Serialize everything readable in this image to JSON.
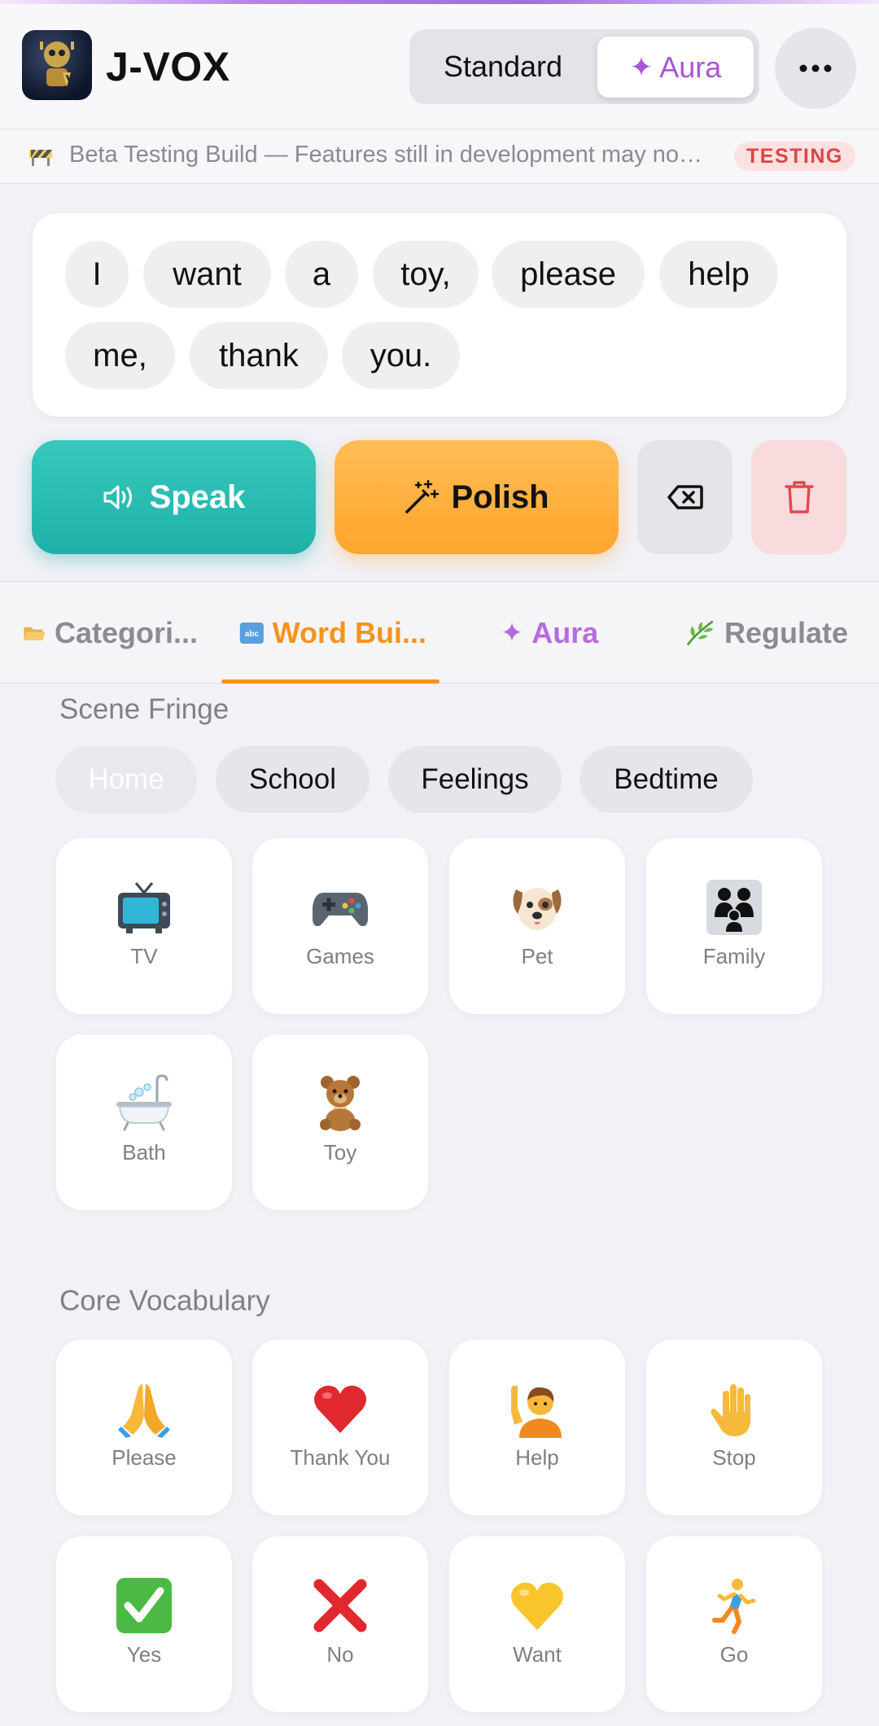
{
  "app": {
    "title": "J-VOX",
    "mode_standard": "Standard",
    "mode_aura": "Aura",
    "more_label": "•••"
  },
  "banner": {
    "text": "Beta Testing Build — Features still in development may not work as expected",
    "badge": "TESTING"
  },
  "sentence": {
    "words": [
      "I",
      "want",
      "a",
      "toy,",
      "please",
      "help",
      "me,",
      "thank",
      "you."
    ]
  },
  "actions": {
    "speak": "Speak",
    "polish": "Polish"
  },
  "tabs": [
    {
      "label": "Categori...",
      "icon": "folder-icon",
      "active": false
    },
    {
      "label": "Word Bui...",
      "icon": "abc-icon",
      "active": true
    },
    {
      "label": "Aura",
      "icon": "sparkle-icon",
      "active": false
    },
    {
      "label": "Regulate",
      "icon": "leaf-icon",
      "active": false
    }
  ],
  "scene_fringe": {
    "title": "Scene Fringe",
    "scenes": [
      "Home",
      "School",
      "Feelings",
      "Bedtime"
    ],
    "selected": "Home",
    "tiles": [
      {
        "label": "TV",
        "icon": "tv-icon"
      },
      {
        "label": "Games",
        "icon": "game-controller-icon"
      },
      {
        "label": "Pet",
        "icon": "dog-icon"
      },
      {
        "label": "Family",
        "icon": "family-icon"
      },
      {
        "label": "Bath",
        "icon": "bathtub-icon"
      },
      {
        "label": "Toy",
        "icon": "teddy-bear-icon"
      }
    ]
  },
  "core_vocabulary": {
    "title": "Core Vocabulary",
    "tiles": [
      {
        "label": "Please",
        "icon": "folded-hands-icon"
      },
      {
        "label": "Thank You",
        "icon": "red-heart-icon"
      },
      {
        "label": "Help",
        "icon": "raised-hand-person-icon"
      },
      {
        "label": "Stop",
        "icon": "raised-hand-icon"
      },
      {
        "label": "Yes",
        "icon": "check-mark-icon"
      },
      {
        "label": "No",
        "icon": "cross-mark-icon"
      },
      {
        "label": "Want",
        "icon": "yellow-heart-icon"
      },
      {
        "label": "Go",
        "icon": "running-person-icon"
      }
    ]
  },
  "colors": {
    "speak": "#23b8ae",
    "polish": "#ffa52c",
    "accent_tab": "#f5931e",
    "aura": "#a855d8",
    "testing": "#d94646"
  }
}
